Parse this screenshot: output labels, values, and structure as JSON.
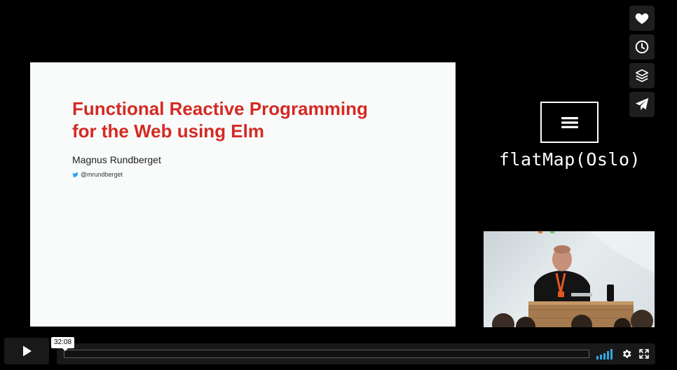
{
  "slide": {
    "title": "Functional Reactive Programming\nfor the Web using Elm",
    "author": "Magnus Rundberget",
    "handle": "@mrundberget"
  },
  "logo": {
    "text": "flatMap(Oslo)",
    "icon": "menu-icon"
  },
  "side_actions": [
    {
      "name": "like",
      "icon": "heart-icon"
    },
    {
      "name": "watch-later",
      "icon": "clock-icon"
    },
    {
      "name": "collections",
      "icon": "layers-icon"
    },
    {
      "name": "share",
      "icon": "paper-plane-icon"
    }
  ],
  "player": {
    "time": "32:08",
    "progress": 0.0,
    "icons": [
      "play-icon",
      "volume-icon",
      "settings-icon",
      "fullscreen-icon"
    ]
  },
  "colors": {
    "title_red": "#d42a23",
    "bar_bg": "#191919",
    "twitter_blue": "#1da1f2"
  }
}
